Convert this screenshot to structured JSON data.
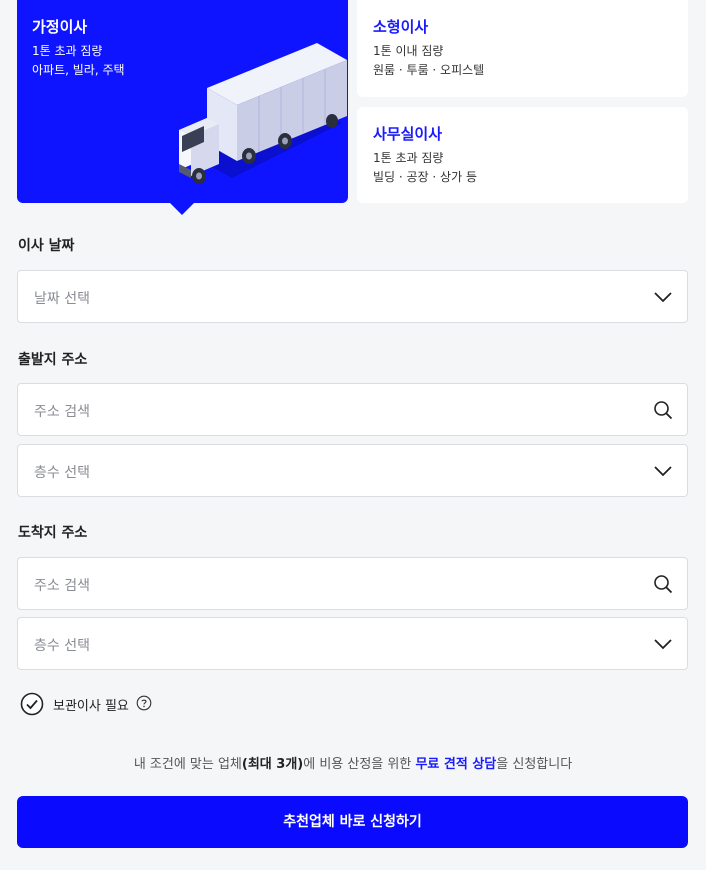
{
  "move_types": {
    "home": {
      "title": "가정이사",
      "line1": "1톤 초과 짐량",
      "line2": "아파트, 빌라, 주택"
    },
    "small": {
      "title": "소형이사",
      "line1": "1톤 이내 짐량",
      "line2": "원룸 · 투룸 · 오피스텔"
    },
    "office": {
      "title": "사무실이사",
      "line1": "1톤 초과 짐량",
      "line2": "빌딩 · 공장 · 상가 등"
    }
  },
  "move_date": {
    "label": "이사 날짜",
    "placeholder": "날짜 선택"
  },
  "departure": {
    "label": "출발지 주소",
    "address_placeholder": "주소 검색",
    "floor_placeholder": "층수 선택"
  },
  "arrival": {
    "label": "도착지 주소",
    "address_placeholder": "주소 검색",
    "floor_placeholder": "층수 선택"
  },
  "storage": {
    "label": "보관이사 필요",
    "checked": true
  },
  "notice": {
    "pre": "내 조건에 맞는 업체",
    "bold": "(최대 3개)",
    "mid": "에 비용 산정을 위한 ",
    "highlight": "무료 견적 상담",
    "post": "을 신청합니다"
  },
  "submit_label": "추천업체 바로 신청하기",
  "colors": {
    "accent": "#0e14ff",
    "link": "#1a1aff",
    "background": "#f5f6f8"
  },
  "icons": {
    "dropdown": "chevron-down-icon",
    "search": "search-icon",
    "check": "check-circle-icon",
    "help": "help-icon"
  }
}
